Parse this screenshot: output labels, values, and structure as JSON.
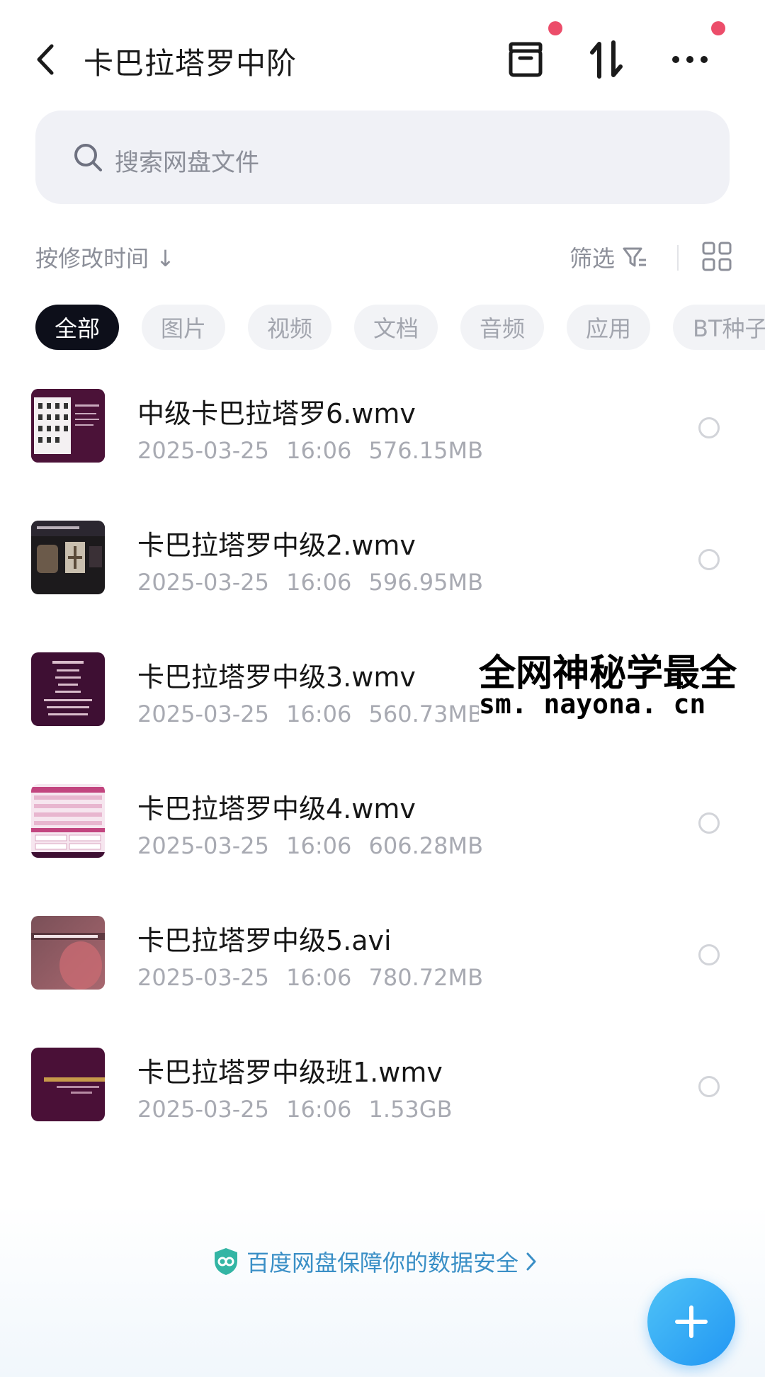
{
  "header": {
    "title": "卡巴拉塔罗中阶",
    "icons": [
      "back-icon",
      "archive-icon",
      "sort-transfer-icon",
      "more-icon"
    ],
    "accent_dot_color": "#ec4d6a"
  },
  "search": {
    "placeholder": "搜索网盘文件",
    "icon": "search-icon"
  },
  "sort": {
    "label": "按修改时间 ↓"
  },
  "filter": {
    "label": "筛选",
    "icon": "filter-icon",
    "view_icon": "grid-view-icon"
  },
  "tabs": [
    {
      "label": "全部",
      "active": true
    },
    {
      "label": "图片",
      "active": false
    },
    {
      "label": "视频",
      "active": false
    },
    {
      "label": "文档",
      "active": false
    },
    {
      "label": "音频",
      "active": false
    },
    {
      "label": "应用",
      "active": false
    },
    {
      "label": "BT种子",
      "active": false
    }
  ],
  "files": [
    {
      "name": "中级卡巴拉塔罗6.wmv",
      "date": "2025-03-25",
      "time": "16:06",
      "size": "576.15MB"
    },
    {
      "name": "卡巴拉塔罗中级2.wmv",
      "date": "2025-03-25",
      "time": "16:06",
      "size": "596.95MB"
    },
    {
      "name": "卡巴拉塔罗中级3.wmv",
      "date": "2025-03-25",
      "time": "16:06",
      "size": "560.73MB"
    },
    {
      "name": "卡巴拉塔罗中级4.wmv",
      "date": "2025-03-25",
      "time": "16:06",
      "size": "606.28MB"
    },
    {
      "name": "卡巴拉塔罗中级5.avi",
      "date": "2025-03-25",
      "time": "16:06",
      "size": "780.72MB"
    },
    {
      "name": "卡巴拉塔罗中级班1.wmv",
      "date": "2025-03-25",
      "time": "16:06",
      "size": "1.53GB"
    }
  ],
  "watermark": {
    "line1": "全网神秘学最全",
    "line2": "sm. nayona. cn"
  },
  "footer": {
    "safety_text": "百度网盘保障你的数据安全",
    "safety_color": "#3a8fc6",
    "fab_icon": "plus-icon"
  }
}
